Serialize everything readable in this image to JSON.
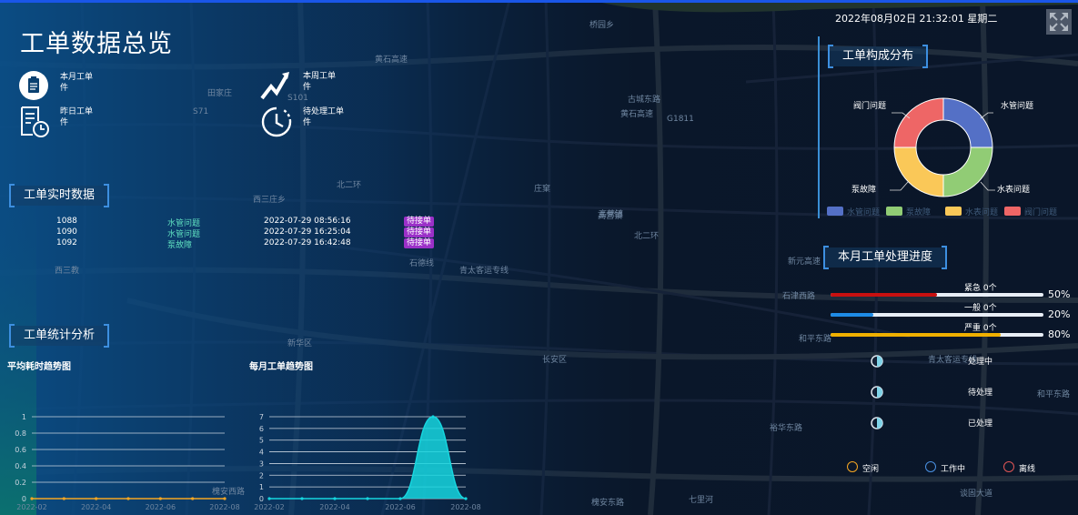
{
  "header": {
    "title": "工单数据总览",
    "datetime": "2022年08月02日 21:32:01 星期二"
  },
  "stats": [
    {
      "label": "本月工单件",
      "icon": "clipboard-icon"
    },
    {
      "label": "本周工单件",
      "icon": "trend-icon"
    },
    {
      "label": "昨日工单件",
      "icon": "receipt-clock-icon"
    },
    {
      "label": "待处理工单件",
      "icon": "clock-icon"
    }
  ],
  "realtime": {
    "title": "工单实时数据",
    "rows": [
      {
        "id": "1088",
        "type": "水管问题",
        "time": "2022-07-29 08:56:16",
        "status": "待接单"
      },
      {
        "id": "1090",
        "type": "水管问题",
        "time": "2022-07-29 16:25:04",
        "status": "待接单"
      },
      {
        "id": "1092",
        "type": "泵故障",
        "time": "2022-07-29 16:42:48",
        "status": "待接单"
      }
    ]
  },
  "analysis": {
    "title": "工单统计分析"
  },
  "composition": {
    "title": "工单构成分布",
    "segment_labels": [
      "阀门问题",
      "水管问题",
      "泵故障",
      "水表问题"
    ],
    "legend": [
      "水管问题",
      "泵故障",
      "水表问题",
      "阀门问题"
    ],
    "colors": [
      "#5470c6",
      "#91cc75",
      "#fac858",
      "#ee6666"
    ]
  },
  "progress": {
    "title": "本月工单处理进度",
    "items": [
      {
        "label": "紧急 0个",
        "pct_text": "50%",
        "value": 0.5,
        "color": "#c81010"
      },
      {
        "label": "一般 0个",
        "pct_text": "20%",
        "value": 0.2,
        "color": "#1e8be6"
      },
      {
        "label": "严重 0个",
        "pct_text": "80%",
        "value": 0.8,
        "color": "#f0b000"
      }
    ]
  },
  "status_list": [
    "处理中",
    "待处理",
    "已处理"
  ],
  "device_legend": [
    {
      "label": "空闲",
      "color": "#f5a623"
    },
    {
      "label": "工作中",
      "color": "#4a90e2"
    },
    {
      "label": "离线",
      "color": "#e05555"
    }
  ],
  "map_labels": [
    "桥园乡",
    "黄石高速",
    "古城东路",
    "G1811",
    "黄石高速",
    "田家庄",
    "S71",
    "S101",
    "北二环",
    "西三庄乡",
    "北二环",
    "庄窠",
    "高营镇",
    "石德线",
    "青太客运专线",
    "新华区",
    "长安区",
    "石津西路",
    "和平东路",
    "青太客运专线",
    "裕华东路",
    "和平东路",
    "槐安西路",
    "槐安东路",
    "七里河",
    "谈固大道",
    "新元高速",
    "高营镇",
    "西三教"
  ],
  "chart_data": [
    {
      "type": "line",
      "title": "平均耗时趋势图",
      "x": [
        "2022-02",
        "2022-03",
        "2022-04",
        "2022-05",
        "2022-06",
        "2022-07",
        "2022-08"
      ],
      "x_tick_labels": [
        "2022-02",
        "2022-04",
        "2022-06",
        "2022-08"
      ],
      "series": [
        {
          "values": [
            0,
            0,
            0,
            0,
            0,
            0,
            0
          ],
          "color": "#f5a623"
        }
      ],
      "ylim": [
        0,
        1
      ],
      "y_ticks": [
        "0",
        "0.2",
        "0.4",
        "0.6",
        "0.8",
        "1"
      ],
      "grid": true
    },
    {
      "type": "area",
      "title": "每月工单趋势图",
      "x": [
        "2022-02",
        "2022-03",
        "2022-04",
        "2022-05",
        "2022-06",
        "2022-07",
        "2022-08"
      ],
      "x_tick_labels": [
        "2022-02",
        "2022-04",
        "2022-06",
        "2022-08"
      ],
      "series": [
        {
          "values": [
            0,
            0,
            0,
            0,
            0,
            7,
            0
          ],
          "color": "#16d6df"
        }
      ],
      "ylim": [
        0,
        7
      ],
      "y_ticks": [
        "0",
        "1",
        "2",
        "3",
        "4",
        "5",
        "6",
        "7"
      ],
      "grid": true
    }
  ]
}
